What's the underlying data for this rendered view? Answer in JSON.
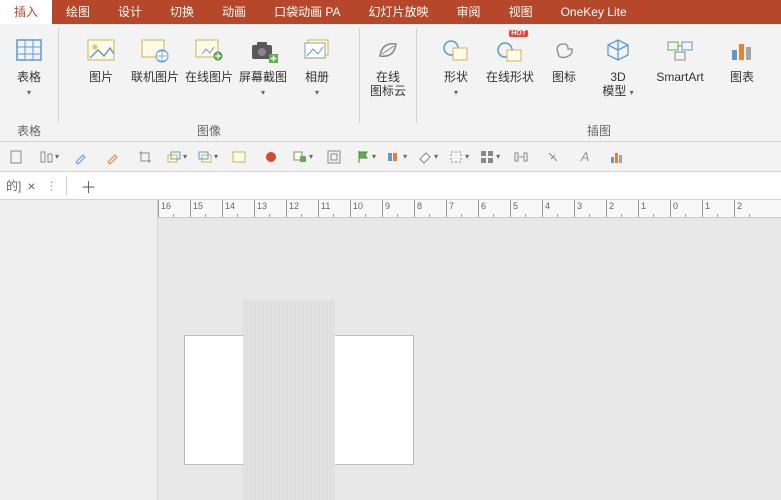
{
  "tabs": {
    "items": [
      "插入",
      "绘图",
      "设计",
      "切换",
      "动画",
      "口袋动画 PA",
      "幻灯片放映",
      "审阅",
      "视图",
      "OneKey Lite"
    ],
    "active_index": 0
  },
  "ribbon": {
    "groups": {
      "tables": {
        "label": "表格",
        "sub": "表格",
        "btn_table": "表格"
      },
      "images": {
        "label": "图像",
        "btn_picture": "图片",
        "btn_online_pic": "联机图片",
        "btn_web_pic": "在线图片",
        "btn_screenshot": "屏幕截图",
        "btn_album": "相册"
      },
      "cloud": {
        "btn_icon_cloud": "在线\n图标云"
      },
      "illustration": {
        "label": "插图",
        "btn_shape": "形状",
        "btn_online_shape": "在线形状",
        "hot": "HOT",
        "btn_icon": "图标",
        "btn_3d": "3D\n模型",
        "btn_smartart": "SmartArt",
        "btn_chart": "图表"
      }
    }
  },
  "docbar": {
    "name_suffix": "的]",
    "close": "×",
    "more": "⋮",
    "plus": "＋"
  },
  "ruler": {
    "ticks": [
      16,
      15,
      14,
      13,
      12,
      11,
      10,
      9,
      8,
      7,
      6,
      5,
      4,
      3,
      2,
      1,
      0,
      1,
      2
    ]
  }
}
